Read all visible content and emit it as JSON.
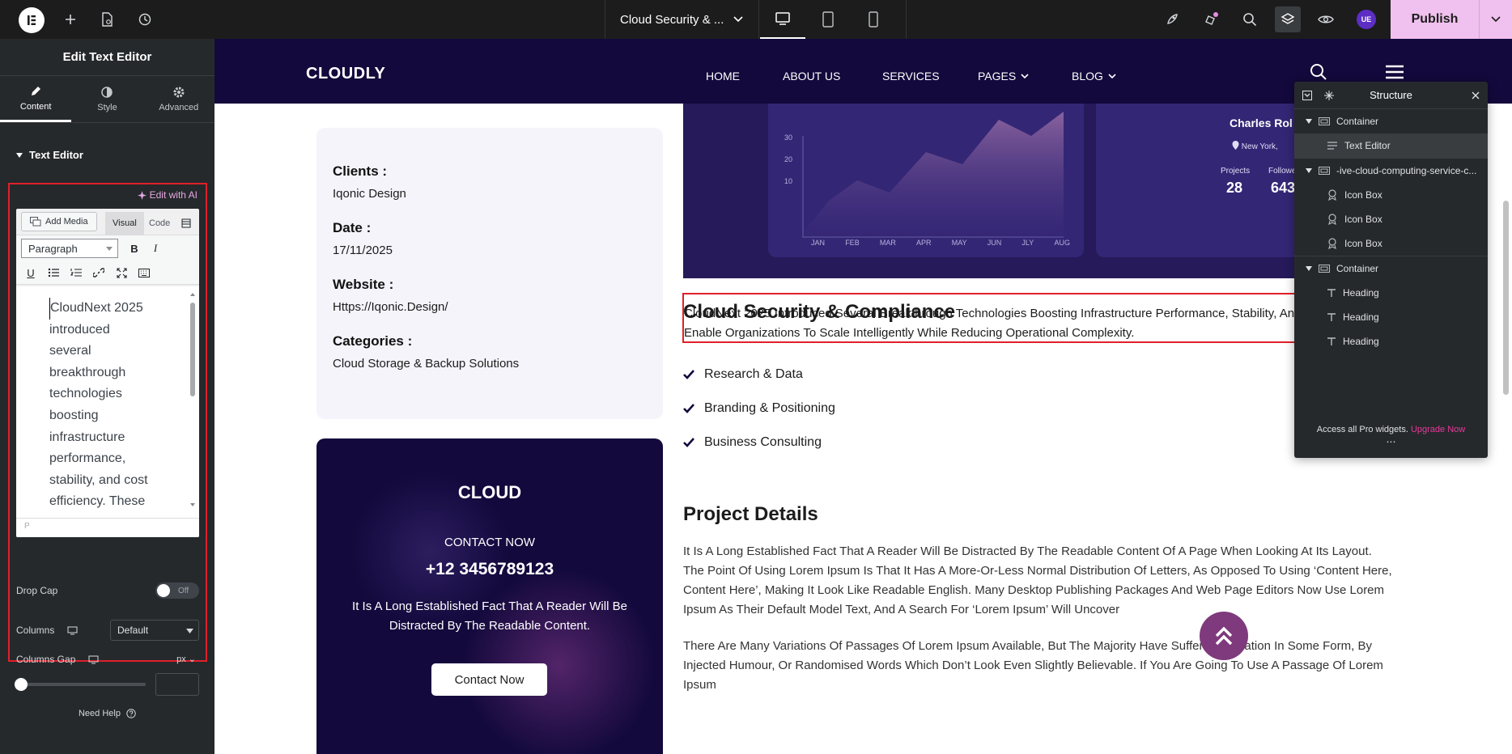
{
  "topbar": {
    "document_title": "Cloud Security & ...",
    "publish_label": "Publish",
    "avatar_initials": "UE",
    "accent_color": "#f0c0ee"
  },
  "panel": {
    "title": "Edit Text Editor",
    "tabs": [
      {
        "label": "Content",
        "icon": "pencil-icon",
        "active": true
      },
      {
        "label": "Style",
        "icon": "half-circle-icon",
        "active": false
      },
      {
        "label": "Advanced",
        "icon": "gear-icon",
        "active": false
      }
    ],
    "section_title": "Text Editor",
    "edit_ai_label": "Edit with AI",
    "add_media_label": "Add Media",
    "visual_tab": "Visual",
    "code_tab": "Code",
    "format_value": "Paragraph",
    "editor_lines": [
      "CloudNext 2025",
      "introduced",
      "several",
      "breakthrough",
      "technologies",
      "boosting",
      "infrastructure",
      "performance,",
      "stability, and cost",
      "efficiency. These"
    ],
    "editor_status": "P",
    "drop_cap_label": "Drop Cap",
    "drop_cap_state": "Off",
    "columns_label": "Columns",
    "columns_value": "Default",
    "columns_gap_label": "Columns Gap",
    "columns_gap_unit": "px",
    "need_help_label": "Need Help"
  },
  "site": {
    "brand": "CLOUDLY",
    "nav": [
      {
        "label": "HOME",
        "dropdown": false
      },
      {
        "label": "ABOUT US",
        "dropdown": false
      },
      {
        "label": "SERVICES",
        "dropdown": false
      },
      {
        "label": "PAGES",
        "dropdown": true
      },
      {
        "label": "BLOG",
        "dropdown": true
      }
    ],
    "info": {
      "clients_label": "Clients :",
      "clients_value": "Iqonic Design",
      "date_label": "Date :",
      "date_value": "17/11/2025",
      "website_label": "Website :",
      "website_value": "Https://Iqonic.Design/",
      "categories_label": "Categories :",
      "categories_value": "Cloud Storage & Backup Solutions"
    },
    "cta": {
      "brand": "CLOUD",
      "contact_label": "CONTACT NOW",
      "phone": "+12 3456789123",
      "text": "It Is A Long Established Fact That A Reader Will Be Distracted By The Readable Content.",
      "button": "Contact Now"
    },
    "dashboard": {
      "y_ticks": [
        "30",
        "20",
        "10"
      ],
      "months": [
        "JAN",
        "FEB",
        "MAR",
        "APR",
        "MAY",
        "JUN",
        "JLY",
        "AUG"
      ],
      "profile_name": "Charles Rol",
      "profile_location": "New York,",
      "projects_label": "Projects",
      "projects_value": "28",
      "followers_label": "Followers",
      "followers_value": "643"
    },
    "heading": "Cloud Security & Compliance",
    "selected_text": "CloudNext 2025 Introduced Several Breakthrough Technologies Boosting Infrastructure Performance, Stability, And Cost Efficiency. These Innovations Enable Organizations To Scale Intelligently While Reducing Operational Complexity.",
    "checklist": [
      "Research & Data",
      "Branding & Positioning",
      "Business Consulting"
    ],
    "project_heading": "Project Details",
    "para1": "It Is A Long Established Fact That A Reader Will Be Distracted By The Readable Content Of A Page When Looking At Its Layout. The Point Of Using Lorem Ipsum Is That It Has A More-Or-Less Normal Distribution Of Letters, As Opposed To Using ‘Content Here, Content Here’, Making It Look Like Readable English. Many Desktop Publishing Packages And Web Page Editors Now Use Lorem Ipsum As Their Default Model Text, And A Search For ‘Lorem Ipsum’ Will Uncover",
    "para2": "There Are Many Variations Of Passages Of Lorem Ipsum Available, But The Majority Have Suffered Alteration In Some Form, By Injected Humour, Or Randomised Words Which Don’t Look Even Slightly Believable. If You Are Going To Use A Passage Of Lorem Ipsum"
  },
  "structure": {
    "title": "Structure",
    "items": [
      {
        "label": "Container",
        "type": "container",
        "level": 0,
        "expanded": true,
        "selected": false
      },
      {
        "label": "Text Editor",
        "type": "text-editor",
        "level": 1,
        "expanded": false,
        "selected": true
      },
      {
        "label": "-ive-cloud-computing-service-c...",
        "type": "container",
        "level": 0,
        "expanded": true,
        "selected": false
      },
      {
        "label": "Icon Box",
        "type": "icon-box",
        "level": 1,
        "expanded": false,
        "selected": false
      },
      {
        "label": "Icon Box",
        "type": "icon-box",
        "level": 1,
        "expanded": false,
        "selected": false
      },
      {
        "label": "Icon Box",
        "type": "icon-box",
        "level": 1,
        "expanded": false,
        "selected": false
      },
      {
        "label": "Container",
        "type": "container",
        "level": 0,
        "expanded": true,
        "selected": false
      },
      {
        "label": "Heading",
        "type": "heading",
        "level": 1,
        "expanded": false,
        "selected": false
      },
      {
        "label": "Heading",
        "type": "heading",
        "level": 1,
        "expanded": false,
        "selected": false
      },
      {
        "label": "Heading",
        "type": "heading",
        "level": 1,
        "expanded": false,
        "selected": false
      }
    ],
    "footer_text": "Access all Pro widgets.",
    "footer_link": "Upgrade Now"
  }
}
